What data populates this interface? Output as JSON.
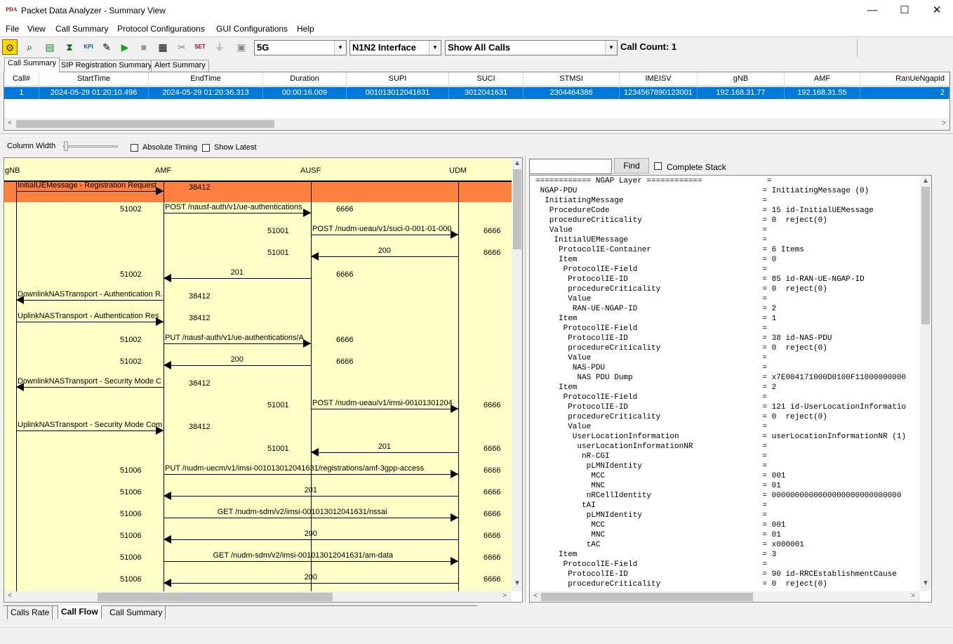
{
  "app": {
    "logo": "PDA",
    "title": "Packet Data Analyzer - Summary View"
  },
  "window_controls": {
    "minimize": "—",
    "maximize": "☐",
    "close": "✕"
  },
  "menu": [
    "File",
    "View",
    "Call Summary",
    "Protocol Configurations",
    "GUI Configurations",
    "Help"
  ],
  "toolbar": {
    "icons": [
      "settings-icon",
      "search-icon",
      "export-icon",
      "filter-icon",
      "kpi-icon",
      "edit-icon",
      "play-icon",
      "stop-icon",
      "report-icon",
      "tools-icon",
      "set-icon",
      "antenna-icon",
      "save-icon"
    ],
    "icon_glyphs": [
      "⚙",
      "⌕",
      "▤",
      "⧗",
      "▥",
      "✎",
      "▶",
      "■",
      "▦",
      "✂",
      "↯",
      "⏚",
      "▣"
    ],
    "kpi_text": "KPI",
    "set_text": "SET",
    "network_select": "5G",
    "interface_select": "N1N2 Interface",
    "calls_select": "Show All Calls",
    "call_count": "Call Count: 1"
  },
  "top_tabs": [
    {
      "label": "Call Summary",
      "active": true
    },
    {
      "label": "SIP Registration Summary",
      "active": false
    },
    {
      "label": "Alert Summary",
      "active": false
    }
  ],
  "call_table": {
    "columns": [
      "Call#",
      "StartTime",
      "EndTime",
      "Duration",
      "SUPI",
      "SUCI",
      "STMSI",
      "IMEISV",
      "gNB",
      "AMF",
      "RanUeNgapId"
    ],
    "rows": [
      [
        "1",
        "2024-05-29 01:20:10.496",
        "2024-05-29 01:20:36.313",
        "00:00:16.009",
        "001013012041631",
        "3012041631",
        "2304464386",
        "1234567890123001",
        "192.168.31.77",
        "192.168.31.55",
        "2"
      ]
    ]
  },
  "controls": {
    "column_width_label": "Column Width",
    "absolute_timing": "Absolute Timing",
    "show_latest": "Show Latest",
    "absolute_timing_checked": false,
    "show_latest_checked": false
  },
  "flow": {
    "nodes": [
      "gNB",
      "AMF",
      "AUSF",
      "UDM"
    ],
    "messages": [
      {
        "label": "InitialUEMessage - Registration Request",
        "from": 0,
        "to": 1,
        "src_port": "",
        "dst_port": "38412",
        "highlighted": true
      },
      {
        "label": "POST /nausf-auth/v1/ue-authentications",
        "from": 1,
        "to": 2,
        "src_port": "51002",
        "dst_port": "6666"
      },
      {
        "label": "POST /nudm-ueau/v1/suci-0-001-01-000",
        "from": 2,
        "to": 3,
        "src_port": "51001",
        "dst_port": "6666"
      },
      {
        "label": "200",
        "from": 3,
        "to": 2,
        "src_port": "51001",
        "dst_port": "6666"
      },
      {
        "label": "201",
        "from": 2,
        "to": 1,
        "src_port": "51002",
        "dst_port": "6666"
      },
      {
        "label": "DownlinkNASTransport - Authentication R...",
        "from": 1,
        "to": 0,
        "src_port": "",
        "dst_port": "38412"
      },
      {
        "label": "UplinkNASTransport - Authentication Res",
        "from": 0,
        "to": 1,
        "src_port": "",
        "dst_port": "38412"
      },
      {
        "label": "PUT /nausf-auth/v1/ue-authentications/A",
        "from": 1,
        "to": 2,
        "src_port": "51002",
        "dst_port": "6666"
      },
      {
        "label": "200",
        "from": 2,
        "to": 1,
        "src_port": "51002",
        "dst_port": "6666"
      },
      {
        "label": "DownlinkNASTransport - Security Mode C...",
        "from": 1,
        "to": 0,
        "src_port": "",
        "dst_port": "38412"
      },
      {
        "label": "POST /nudm-ueau/v1/imsi-00101301204",
        "from": 2,
        "to": 3,
        "src_port": "51001",
        "dst_port": "6666"
      },
      {
        "label": "UplinkNASTransport - Security Mode Com",
        "from": 0,
        "to": 1,
        "src_port": "",
        "dst_port": "38412"
      },
      {
        "label": "201",
        "from": 3,
        "to": 2,
        "src_port": "51001",
        "dst_port": "6666"
      },
      {
        "label": "PUT /nudm-uecm/v1/imsi-001013012041631/registrations/amf-3gpp-access",
        "from": 1,
        "to": 3,
        "src_port": "51006",
        "dst_port": "6666"
      },
      {
        "label": "201",
        "from": 3,
        "to": 1,
        "src_port": "51006",
        "dst_port": "6666"
      },
      {
        "label": "GET /nudm-sdm/v2/imsi-001013012041631/nssai",
        "from": 1,
        "to": 3,
        "src_port": "51006",
        "dst_port": "6666"
      },
      {
        "label": "200",
        "from": 3,
        "to": 1,
        "src_port": "51006",
        "dst_port": "6666"
      },
      {
        "label": "GET /nudm-sdm/v2/imsi-001013012041631/am-data",
        "from": 1,
        "to": 3,
        "src_port": "51006",
        "dst_port": "6666"
      },
      {
        "label": "200",
        "from": 3,
        "to": 1,
        "src_port": "51006",
        "dst_port": "6666"
      }
    ]
  },
  "detail": {
    "find_button": "Find",
    "find_value": "",
    "complete_stack": "Complete Stack",
    "complete_stack_checked": false,
    "lines": [
      "============ NGAP Layer ============              =",
      " NGAP-PDU                                        = InitiatingMessage (0)",
      "  InitiatingMessage                              =",
      "   ProcedureCode                                 = 15 id-InitialUEMessage",
      "   procedureCriticality                          = 0  reject(0)",
      "   Value                                         =",
      "    InitialUEMessage                             =",
      "     ProtocolIE-Container                        = 6 Items",
      "     Item                                        = 0",
      "      ProtocolIE-Field                           =",
      "       ProtocolIE-ID                             = 85 id-RAN-UE-NGAP-ID",
      "       procedureCriticality                      = 0  reject(0)",
      "       Value                                     =",
      "        RAN-UE-NGAP-ID                           = 2",
      "     Item                                        = 1",
      "      ProtocolIE-Field                           =",
      "       ProtocolIE-ID                             = 38 id-NAS-PDU",
      "       procedureCriticality                      = 0  reject(0)",
      "       Value                                     =",
      "        NAS-PDU                                  =",
      "         NAS PDU Dump                            = x7E004171000D0100F11000000000",
      "     Item                                        = 2",
      "      ProtocolIE-Field                           =",
      "       ProtocolIE-ID                             = 121 id-UserLocationInformatio",
      "       procedureCriticality                      = 0  reject(0)",
      "       Value                                     =",
      "        UserLocationInformation                  = userLocationInformationNR (1)",
      "         userLocationInformationNR               =",
      "          nR-CGI                                 =",
      "           pLMNIdentity                          =",
      "            MCC                                  = 001",
      "            MNC                                  = 01",
      "           nRCellIdentity                        = 0000000000000000000000000000",
      "          tAI                                    =",
      "           pLMNIdentity                          =",
      "            MCC                                  = 001",
      "            MNC                                  = 01",
      "           tAC                                   = x000001",
      "     Item                                        = 3",
      "      ProtocolIE-Field                           =",
      "       ProtocolIE-ID                             = 90 id-RRCEstablishmentCause",
      "       procedureCriticality                      = 0  reject(0)"
    ]
  },
  "bottom_tabs": [
    {
      "label": "Calls Rate",
      "active": false
    },
    {
      "label": "Call Flow",
      "active": true
    },
    {
      "label": "Call Summary",
      "active": false
    }
  ],
  "scroll_arrows": {
    "up": "▲",
    "down": "▼",
    "left": "<",
    "right": ">",
    "dropdown": "▼"
  },
  "colors": {
    "highlight_row": "#ff7f3f",
    "flow_background": "#ffffc8",
    "selected_row": "#0078d7"
  }
}
